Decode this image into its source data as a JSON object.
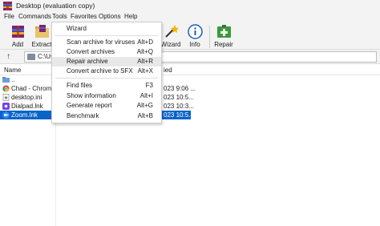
{
  "window": {
    "title": "Desktop (evaluation copy)"
  },
  "menubar": {
    "items": [
      {
        "label": "File"
      },
      {
        "label": "Commands"
      },
      {
        "label": "Tools"
      },
      {
        "label": "Favorites"
      },
      {
        "label": "Options"
      },
      {
        "label": "Help"
      }
    ]
  },
  "toolbar": {
    "add_label": "Add",
    "extract_label": "Extract",
    "wizard_label": "Wizard",
    "info_label": "Info",
    "repair_label": "Repair"
  },
  "address": {
    "path": "C:\\Us"
  },
  "list": {
    "col_name": "Name",
    "col_modified": "ied",
    "rows": [
      {
        "name": "..",
        "modified": ""
      },
      {
        "name": "Chad - Chrome...",
        "modified": "023 9:06 ..."
      },
      {
        "name": "desktop.ini",
        "modified": "023 10:5..."
      },
      {
        "name": "Dialpad.lnk",
        "modified": "023 10:3..."
      },
      {
        "name": "Zoom.lnk",
        "modified": "023 10:5..."
      }
    ]
  },
  "tools_menu": {
    "wizard": {
      "label": "Wizard",
      "shortcut": ""
    },
    "scan": {
      "label": "Scan archive for viruses",
      "shortcut": "Alt+D"
    },
    "convert": {
      "label": "Convert archives",
      "shortcut": "Alt+Q"
    },
    "repair": {
      "label": "Repair archive",
      "shortcut": "Alt+R"
    },
    "sfx": {
      "label": "Convert archive to SFX",
      "shortcut": "Alt+X"
    },
    "find": {
      "label": "Find files",
      "shortcut": "F3"
    },
    "info": {
      "label": "Show information",
      "shortcut": "Alt+I"
    },
    "report": {
      "label": "Generate report",
      "shortcut": "Alt+G"
    },
    "bench": {
      "label": "Benchmark",
      "shortcut": "Alt+B"
    }
  },
  "colors": {
    "selection": "#0a64c8",
    "menu_hover": "#e8e8e8",
    "chrome": "#f3f3f3"
  }
}
